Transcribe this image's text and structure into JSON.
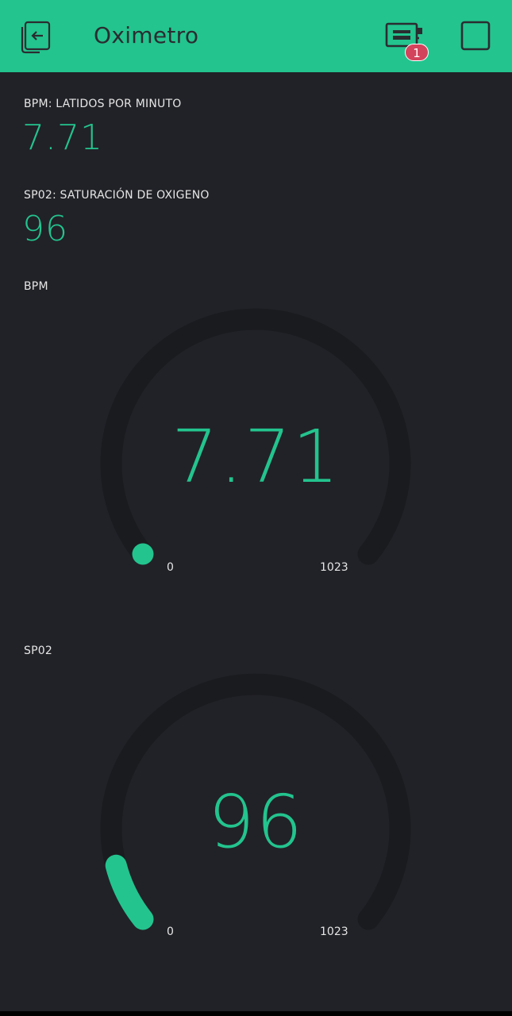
{
  "app_bar": {
    "title": "Oximetro",
    "badge_count": "1",
    "icons": {
      "back": "exit-icon",
      "device": "device-board-icon",
      "stop": "stop-square-icon"
    },
    "colors": {
      "background": "#23c48e",
      "badge": "#d3435c"
    }
  },
  "displays": [
    {
      "label": "BPM: LATIDOS POR MINUTO",
      "value": "7.71"
    },
    {
      "label": "SP02: SATURACIÓN DE OXIGENO",
      "value": "96"
    }
  ],
  "gauges": [
    {
      "label": "BPM",
      "value": "7.71",
      "min": "0",
      "max": "1023"
    },
    {
      "label": "SP02",
      "value": "96",
      "min": "0",
      "max": "1023"
    }
  ],
  "colors": {
    "accent": "#23c48e",
    "background": "#212227",
    "track": "#1a1b1f"
  }
}
